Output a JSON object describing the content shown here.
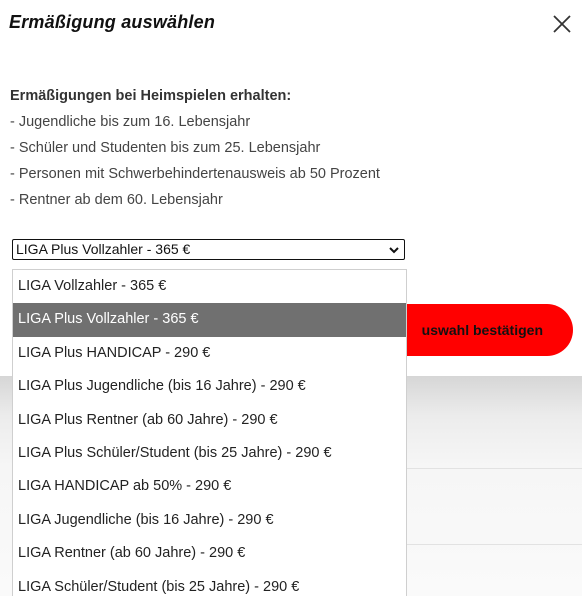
{
  "modal": {
    "title": "Ermäßigung auswählen",
    "close_icon": "close-icon"
  },
  "info": {
    "heading": "Ermäßigungen bei Heimspielen erhalten:",
    "items": [
      "- Jugendliche bis zum 16. Lebensjahr",
      "- Schüler und Studenten bis zum 25. Lebensjahr",
      "- Personen mit Schwerbehindertenausweis ab 50 Prozent",
      "- Rentner ab dem 60. Lebensjahr"
    ]
  },
  "select": {
    "value": "LIGA Plus Vollzahler - 365 €",
    "options": [
      "LIGA Vollzahler - 365 €",
      "LIGA Plus Vollzahler - 365 €",
      "LIGA Plus HANDICAP - 290 €",
      "LIGA Plus Jugendliche (bis 16 Jahre) - 290 €",
      "LIGA Plus Rentner (ab 60 Jahre) - 290 €",
      "LIGA Plus Schüler/Student (bis 25 Jahre) - 290 €",
      "LIGA HANDICAP ab 50% - 290 €",
      "LIGA Jugendliche (bis 16 Jahre) - 290 €",
      "LIGA Rentner (ab 60 Jahre) - 290 €",
      "LIGA Schüler/Student (bis 25 Jahre) - 290 €"
    ],
    "highlighted_index": 1
  },
  "confirm_button": {
    "label": "uswahl bestätigen"
  },
  "colors": {
    "accent": "#ff0000",
    "highlight": "#707070"
  }
}
